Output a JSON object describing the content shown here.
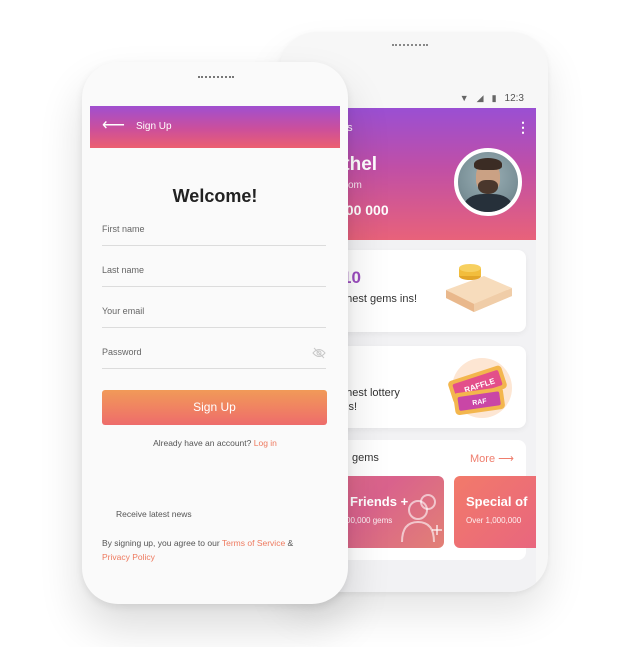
{
  "back_phone": {
    "status": {
      "time": "12:3"
    },
    "header": {
      "title": "ms",
      "user_name": "ithel",
      "email": "l.com",
      "gems": "000 000"
    },
    "cards": [
      {
        "value": "10",
        "text": "ghest gems ins!"
      },
      {
        "value": "",
        "text": "ghest lottery ins!"
      }
    ],
    "gems_section": {
      "label": "gems",
      "more": "More ⟶",
      "tiles": [
        {
          "title": "Friends +",
          "subtitle": "00,000 gems"
        },
        {
          "title": "Special of",
          "subtitle": "Over 1,000,000"
        }
      ]
    },
    "raffle_text_1": "RAFFLE",
    "raffle_text_2": "RAF"
  },
  "front_phone": {
    "header_title": "Sign Up",
    "welcome": "Welcome!",
    "fields": {
      "first_name": "First name",
      "last_name": "Last name",
      "email": "Your email",
      "password": "Password"
    },
    "signup_button": "Sign Up",
    "have_account": "Already have an account?",
    "login_link": "Log in",
    "receive_news": "Receive latest news",
    "agree_prefix": "By signing up, you agree to our ",
    "terms_link": "Terms of Service",
    "agree_amp": " &",
    "privacy_link": "Privacy Policy"
  }
}
